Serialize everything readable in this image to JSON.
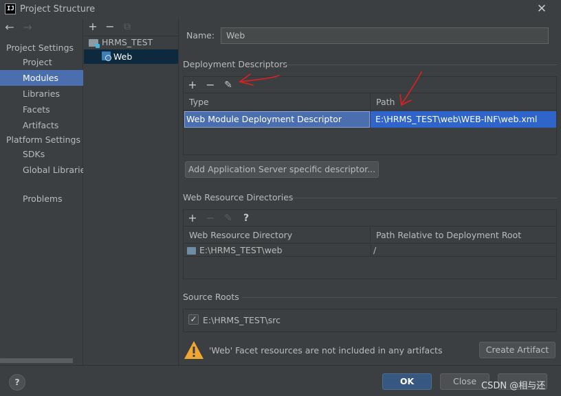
{
  "window": {
    "title": "Project Structure",
    "app_icon_text": "IJ",
    "close_glyph": "✕"
  },
  "nav": {
    "back_glyph": "←",
    "forward_glyph": "→"
  },
  "sidebar": {
    "project_settings_header": "Project Settings",
    "platform_settings_header": "Platform Settings",
    "items": [
      {
        "label": "Project"
      },
      {
        "label": "Modules"
      },
      {
        "label": "Libraries"
      },
      {
        "label": "Facets"
      },
      {
        "label": "Artifacts"
      },
      {
        "label": "SDKs"
      },
      {
        "label": "Global Libraries"
      },
      {
        "label": "Problems"
      }
    ],
    "selected": "Modules"
  },
  "tree": {
    "toolbar": {
      "add": "+",
      "remove": "−",
      "copy": "⧉"
    },
    "root_label": "HRMS_TEST",
    "child_label": "Web"
  },
  "main": {
    "name_label": "Name:",
    "name_value": "Web",
    "deployment": {
      "title": "Deployment Descriptors",
      "toolbar": {
        "add": "+",
        "remove": "−",
        "edit": "✎"
      },
      "columns": [
        "Type",
        "Path"
      ],
      "rows": [
        {
          "type": "Web Module Deployment Descriptor",
          "path": "E:\\HRMS_TEST\\web\\WEB-INF\\web.xml"
        }
      ],
      "add_server_button": "Add Application Server specific descriptor..."
    },
    "web_resources": {
      "title": "Web Resource Directories",
      "toolbar": {
        "add": "+",
        "remove": "−",
        "edit": "✎",
        "help": "?"
      },
      "columns": [
        "Web Resource Directory",
        "Path Relative to Deployment Root"
      ],
      "rows": [
        {
          "directory": "E:\\HRMS_TEST\\web",
          "relative": "/"
        }
      ]
    },
    "source_roots": {
      "title": "Source Roots",
      "checked": true,
      "check_glyph": "✓",
      "items": [
        "E:\\HRMS_TEST\\src"
      ]
    },
    "warning": {
      "text": "'Web' Facet resources are not included in any artifacts",
      "create_artifact_button": "Create Artifact"
    }
  },
  "footer": {
    "help_glyph": "?",
    "ok_button": "OK",
    "close_button": "Close"
  },
  "watermark": "CSDN @相与还",
  "colors": {
    "background": "#3c3f41",
    "selection": "#4b6eaf",
    "table_selection": "#2f65ca",
    "annotation_arrow": "#e02020",
    "warning": "#f0a732"
  }
}
